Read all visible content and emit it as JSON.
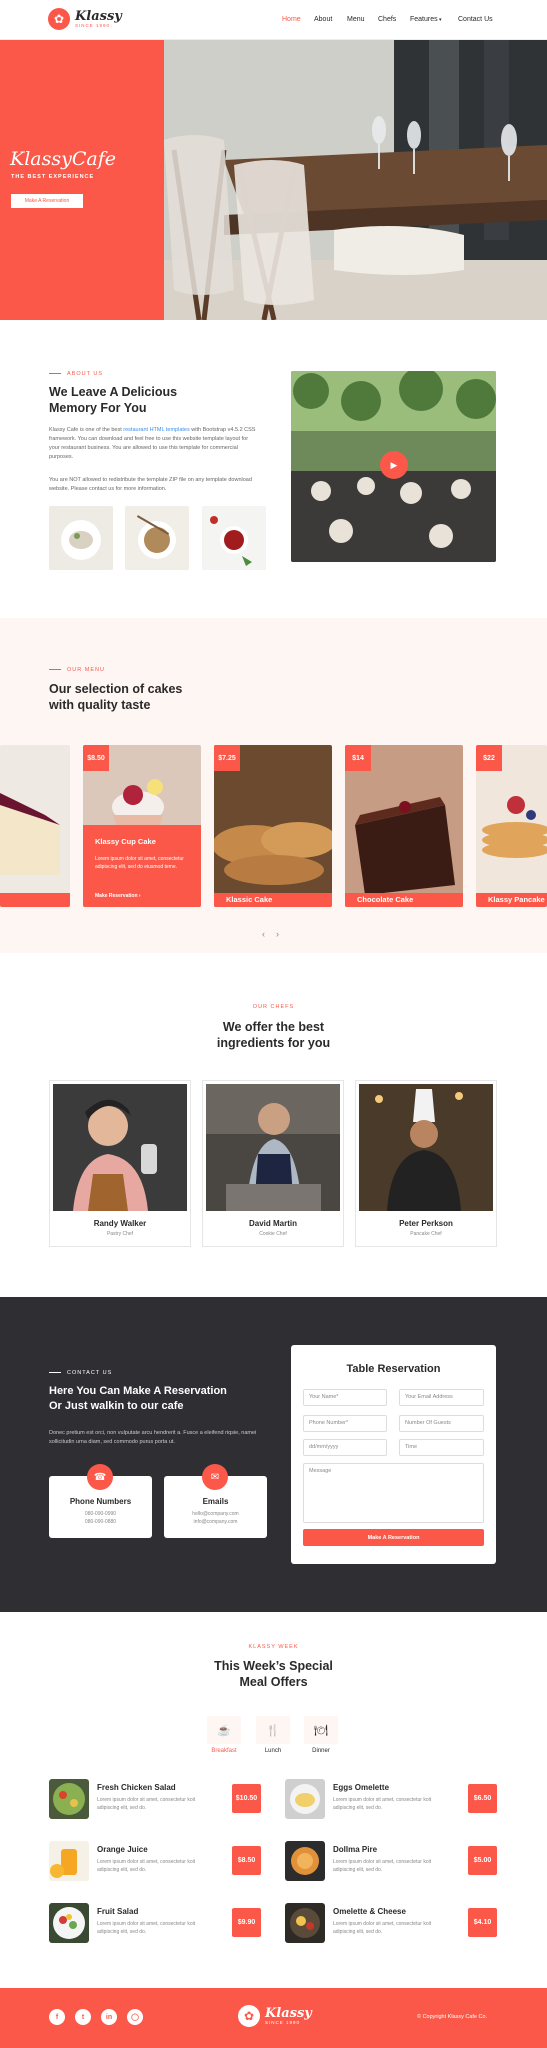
{
  "brand": {
    "name": "Klassy",
    "since": "SINCE 1990"
  },
  "nav": [
    "Home",
    "About",
    "Menu",
    "Chefs",
    "Features",
    "Contact Us"
  ],
  "hero": {
    "title": "KlassyCafe",
    "subtitle": "THE BEST EXPERIENCE",
    "button": "Make A Reservation"
  },
  "about": {
    "eyebrow": "ABOUT US",
    "title_line1": "We Leave A Delicious",
    "title_line2": "Memory For You",
    "p1_a": "Klassy Cafe is one of the best ",
    "p1_link": "restaurant HTML templates",
    "p1_b": " with Bootstrap v4.5.2 CSS framework. You can download and feel free to use this website template layout for your restaurant business. You are allowed to use this template for commercial purposes.",
    "p2": "You are NOT allowed to redistribute the template ZIP file on any template download website. Please contact us for more information."
  },
  "menu": {
    "eyebrow": "OUR MENU",
    "title_line1": "Our selection of cakes",
    "title_line2": "with quality taste",
    "cards": [
      {
        "price": "$8.50",
        "name": "Klassy Cup Cake",
        "desc": "Lorem ipsum dolor sit amet, consectetur adipiscing elit, sed do eiusmod teme.",
        "link": "Make Reservation ›"
      },
      {
        "price": "$7.25",
        "name": "Klassic Cake"
      },
      {
        "price": "$14",
        "name": "Chocolate Cake"
      },
      {
        "price": "$22",
        "name": "Klassy Pancake"
      }
    ]
  },
  "chefs": {
    "eyebrow": "OUR CHEFS",
    "title_line1": "We offer the best",
    "title_line2": "ingredients for you",
    "items": [
      {
        "name": "Randy Walker",
        "role": "Pastry Chef"
      },
      {
        "name": "David Martin",
        "role": "Cookie Chef"
      },
      {
        "name": "Peter Perkson",
        "role": "Pancake Chef"
      }
    ]
  },
  "contact": {
    "eyebrow": "CONTACT US",
    "title_line1": "Here You Can Make A Reservation",
    "title_line2": "Or Just walkin to our cafe",
    "para": "Donec pretium est orci, non vulputate arcu hendrerit a. Fusce a eleifend riqsie, namei sollicitudin urna diam, sed commodo purus porta ut.",
    "phone_title": "Phone Numbers",
    "phone1": "080-090-0990",
    "phone2": "080-090-0880",
    "email_title": "Emails",
    "email1": "hello@company.com",
    "email2": "info@company.com"
  },
  "form": {
    "title": "Table Reservation",
    "name": "Your Name*",
    "email": "Your Email Address",
    "phone": "Phone Number*",
    "guests": "Number Of Guests",
    "date": "dd/mm/yyyy",
    "time": "Time",
    "message": "Message",
    "submit": "Make A Reservation"
  },
  "week": {
    "eyebrow": "KLASSY WEEK",
    "title_line1": "This Week’s Special",
    "title_line2": "Meal Offers",
    "tabs": [
      "Breakfast",
      "Lunch",
      "Dinner"
    ],
    "dishes": [
      {
        "name": "Fresh Chicken Salad",
        "desc": "Lorem ipsum dolor sit amet, consectetur koit adipiscing elit, sed do.",
        "price": "$10.50"
      },
      {
        "name": "Eggs Omelette",
        "desc": "Lorem ipsum dolor sit amet, consectetur koit adipiscing elit, sed do.",
        "price": "$6.50"
      },
      {
        "name": "Orange Juice",
        "desc": "Lorem ipsum dolor sit amet, consectetur koit adipiscing elit, sed do.",
        "price": "$8.50"
      },
      {
        "name": "Dollma Pire",
        "desc": "Lorem ipsum dolor sit amet, consectetur koit adipiscing elit, sed do.",
        "price": "$5.00"
      },
      {
        "name": "Fruit Salad",
        "desc": "Lorem ipsum dolor sit amet, consectetur koit adipiscing elit, sed do.",
        "price": "$9.90"
      },
      {
        "name": "Omelette & Cheese",
        "desc": "Lorem ipsum dolor sit amet, consectetur koit adipiscing elit, sed do.",
        "price": "$4.10"
      }
    ]
  },
  "footer": {
    "copyright": "© Copyright Klassy Cafe Co."
  },
  "colors": {
    "accent": "#fb5849",
    "dark": "#2f2e33",
    "cream": "#fdf6f3"
  },
  "icons": [
    "play-icon",
    "phone-icon",
    "email-icon",
    "facebook-icon",
    "twitter-icon",
    "linkedin-icon",
    "instagram-icon"
  ]
}
